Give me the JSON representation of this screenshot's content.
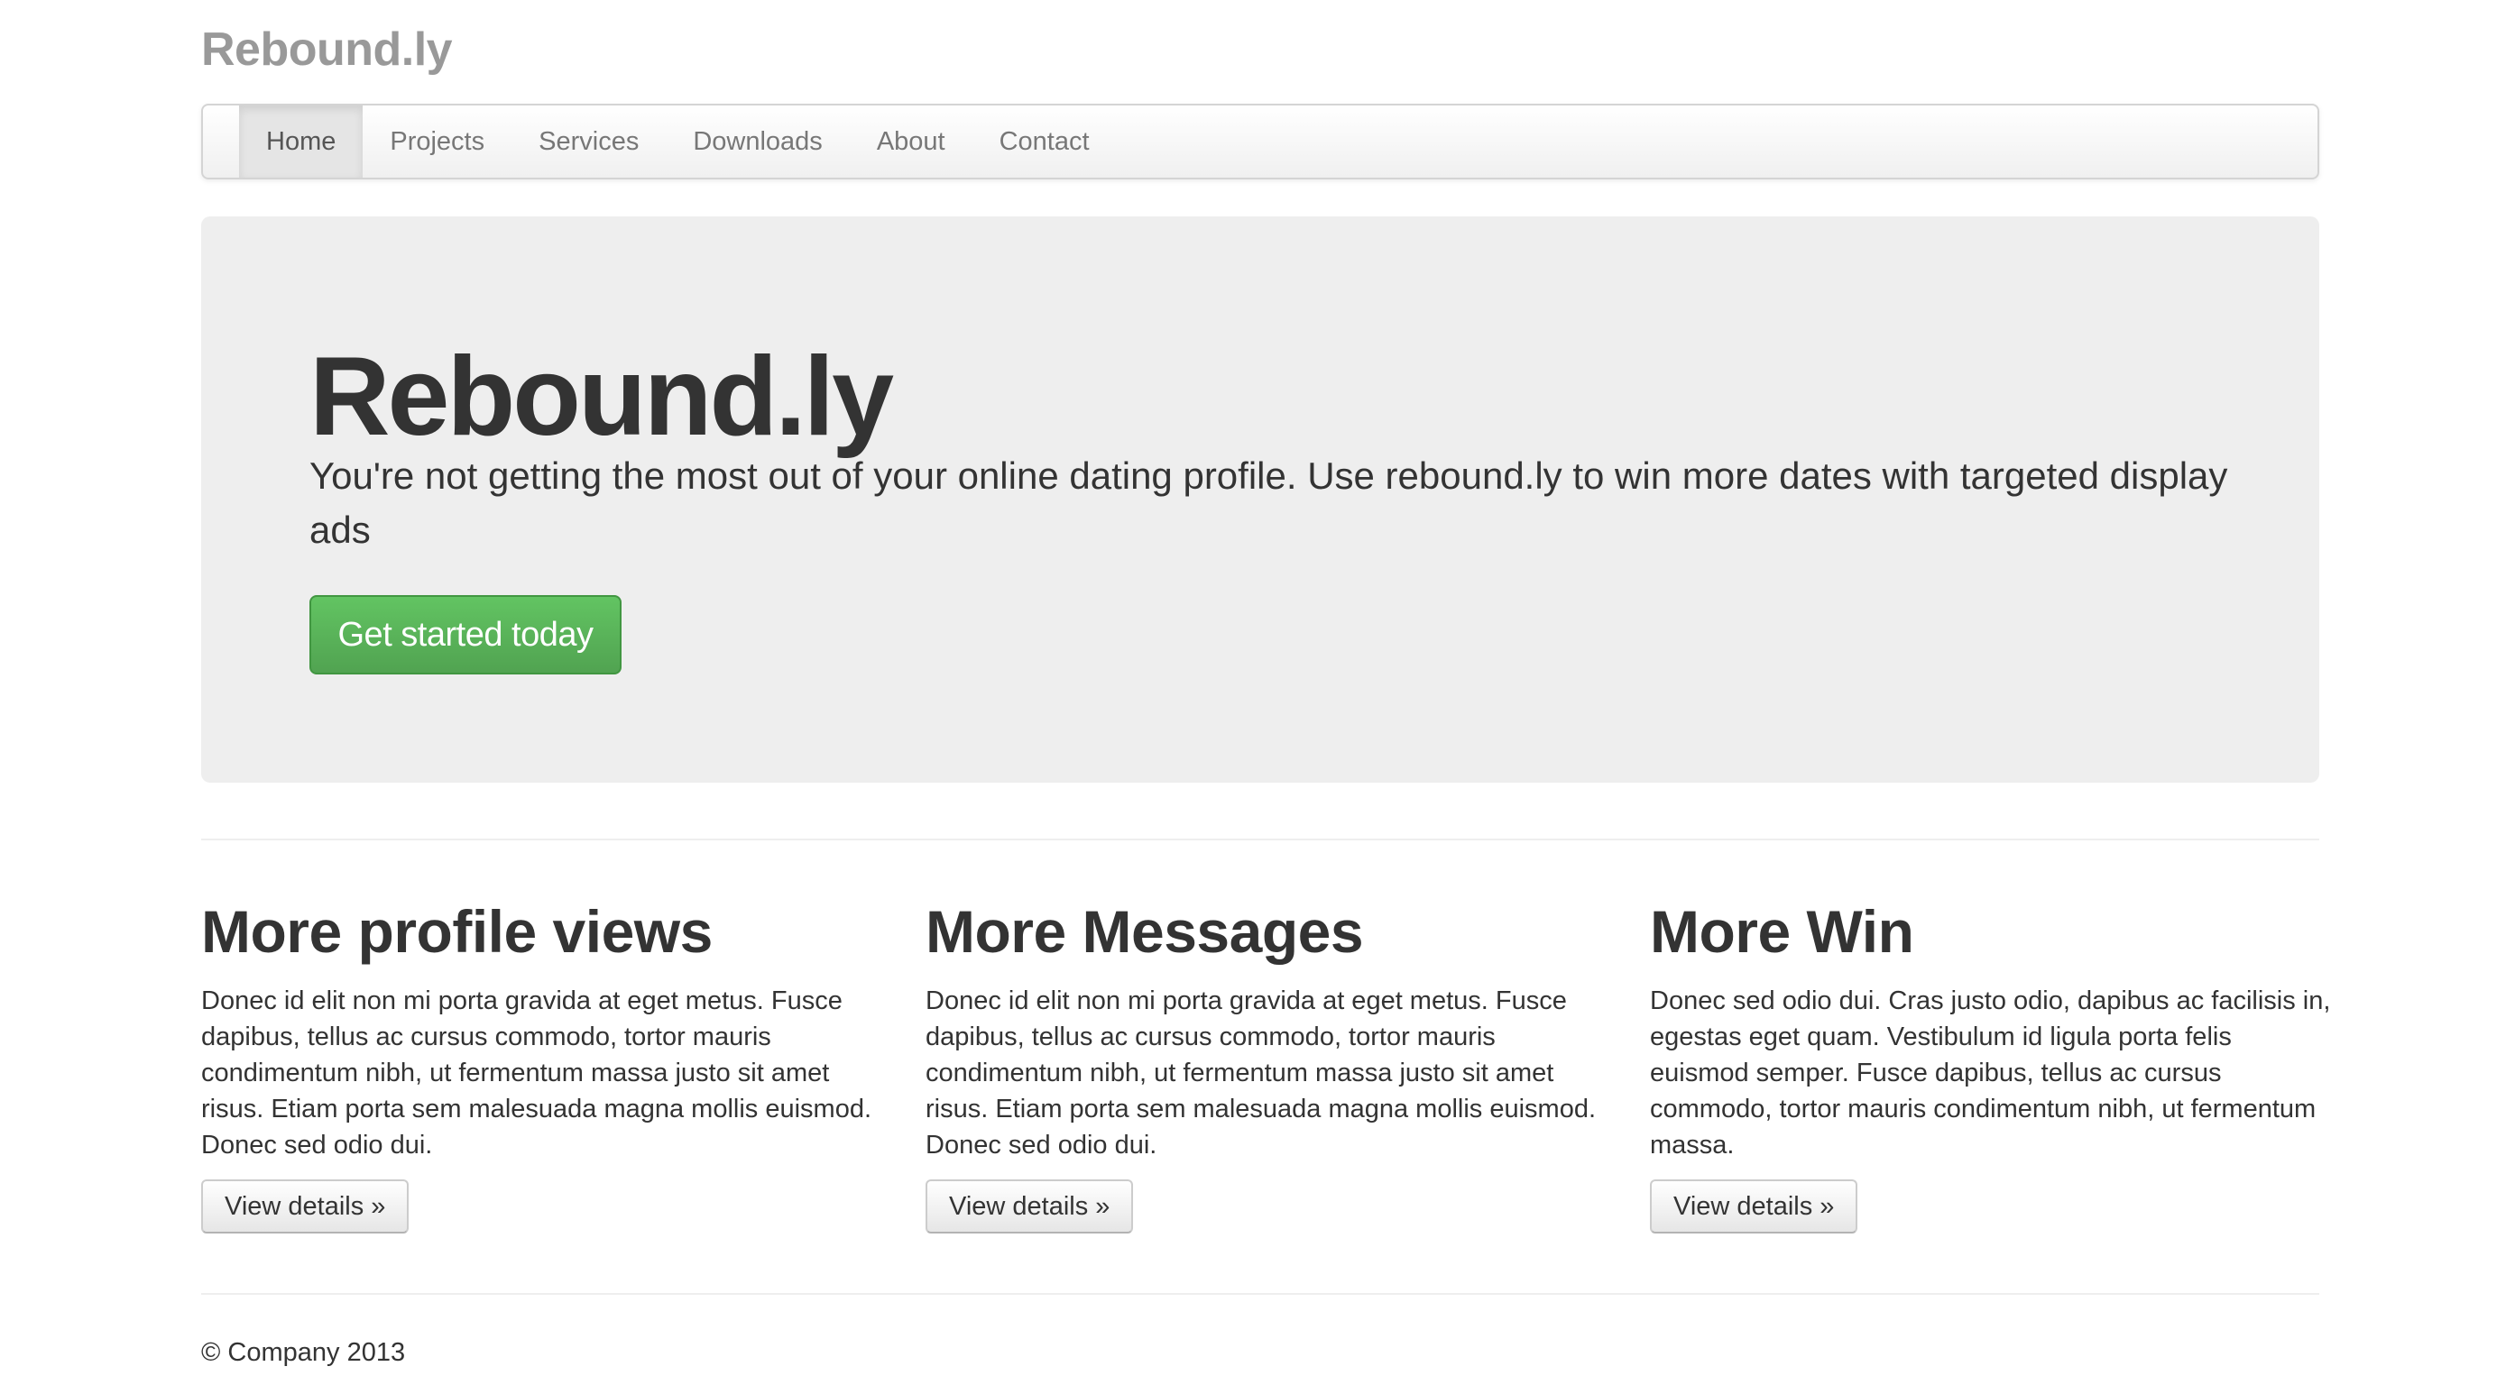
{
  "brand": "Rebound.ly",
  "nav": {
    "items": [
      {
        "label": "Home",
        "active": true
      },
      {
        "label": "Projects",
        "active": false
      },
      {
        "label": "Services",
        "active": false
      },
      {
        "label": "Downloads",
        "active": false
      },
      {
        "label": "About",
        "active": false
      },
      {
        "label": "Contact",
        "active": false
      }
    ]
  },
  "hero": {
    "title": "Rebound.ly",
    "lead": "You're not getting the most out of your online dating profile. Use rebound.ly to win more dates with targeted display ads",
    "cta_label": "Get started today"
  },
  "features": [
    {
      "heading": "More profile views",
      "body": "Donec id elit non mi porta gravida at eget metus. Fusce dapibus, tellus ac cursus commodo, tortor mauris condimentum nibh, ut fermentum massa justo sit amet risus. Etiam porta sem malesuada magna mollis euismod. Donec sed odio dui.",
      "button_label": "View details »"
    },
    {
      "heading": "More Messages",
      "body": "Donec id elit non mi porta gravida at eget metus. Fusce dapibus, tellus ac cursus commodo, tortor mauris condimentum nibh, ut fermentum massa justo sit amet risus. Etiam porta sem malesuada magna mollis euismod. Donec sed odio dui.",
      "button_label": "View details »"
    },
    {
      "heading": "More Win",
      "body": "Donec sed odio dui. Cras justo odio, dapibus ac facilisis in, egestas eget quam. Vestibulum id ligula porta felis euismod semper. Fusce dapibus, tellus ac cursus commodo, tortor mauris condimentum nibh, ut fermentum massa.",
      "button_label": "View details »"
    }
  ],
  "footer": {
    "text": "© Company 2013"
  },
  "colors": {
    "brand_text": "#999999",
    "hero_background": "#eeeeee",
    "cta_green": "#5bb75b"
  }
}
